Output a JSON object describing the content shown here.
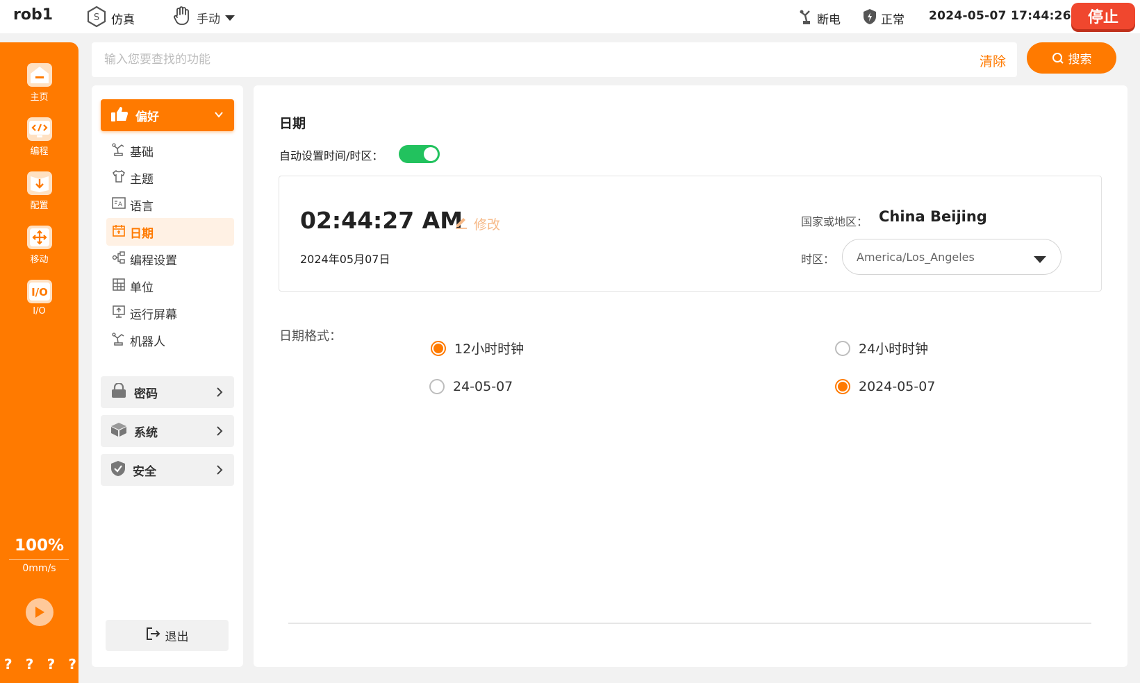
{
  "topbar": {
    "robot_name": "rob1",
    "sim_label": "仿真",
    "manual_label": "手动",
    "power_label": "断电",
    "status_label": "正常",
    "datetime": "2024-05-07 17:44:26",
    "stop_label": "停止"
  },
  "rail": {
    "items": [
      {
        "label": "主页",
        "icon": "home-icon"
      },
      {
        "label": "编程",
        "icon": "code-icon"
      },
      {
        "label": "配置",
        "icon": "download-icon"
      },
      {
        "label": "移动",
        "icon": "move-icon"
      },
      {
        "label": "I/O",
        "icon": "io-icon"
      }
    ],
    "speed_percent": "100%",
    "speed_value": "0mm/s",
    "help": [
      "?",
      "?",
      "?",
      "?"
    ]
  },
  "search": {
    "placeholder": "输入您要查找的功能",
    "clear_label": "清除",
    "button_label": "搜索"
  },
  "nav": {
    "open_group": "偏好",
    "sub_items": [
      {
        "label": "基础",
        "icon": "robot-arm-icon"
      },
      {
        "label": "主题",
        "icon": "shirt-icon"
      },
      {
        "label": "语言",
        "icon": "language-icon"
      },
      {
        "label": "日期",
        "icon": "calendar-icon",
        "active": true
      },
      {
        "label": "编程设置",
        "icon": "flow-icon"
      },
      {
        "label": "单位",
        "icon": "grid-icon"
      },
      {
        "label": "运行屏幕",
        "icon": "screen-icon"
      },
      {
        "label": "机器人",
        "icon": "robot-arm-icon"
      }
    ],
    "closed_groups": [
      {
        "label": "密码",
        "icon": "lock-icon"
      },
      {
        "label": "系统",
        "icon": "box-icon"
      },
      {
        "label": "安全",
        "icon": "shield-icon"
      }
    ],
    "logout_label": "退出"
  },
  "date_page": {
    "title": "日期",
    "auto_label": "自动设置时间/时区：",
    "auto_enabled": true,
    "time": "02:44:27 AM",
    "edit_label": "修改",
    "date": "2024年05月07日",
    "country_label": "国家或地区：",
    "country_value": "China Beijing",
    "timezone_label": "时区：",
    "timezone_value": "America/Los_Angeles",
    "format_label": "日期格式：",
    "options": {
      "clock_12": "12小时时钟",
      "clock_24": "24小时时钟",
      "short_date": "24-05-07",
      "long_date": "2024-05-07"
    },
    "selected": {
      "clock": "12",
      "date": "long"
    }
  },
  "colors": {
    "accent": "#ff7a00",
    "stop": "#f0472e",
    "toggle_on": "#22c25e"
  }
}
